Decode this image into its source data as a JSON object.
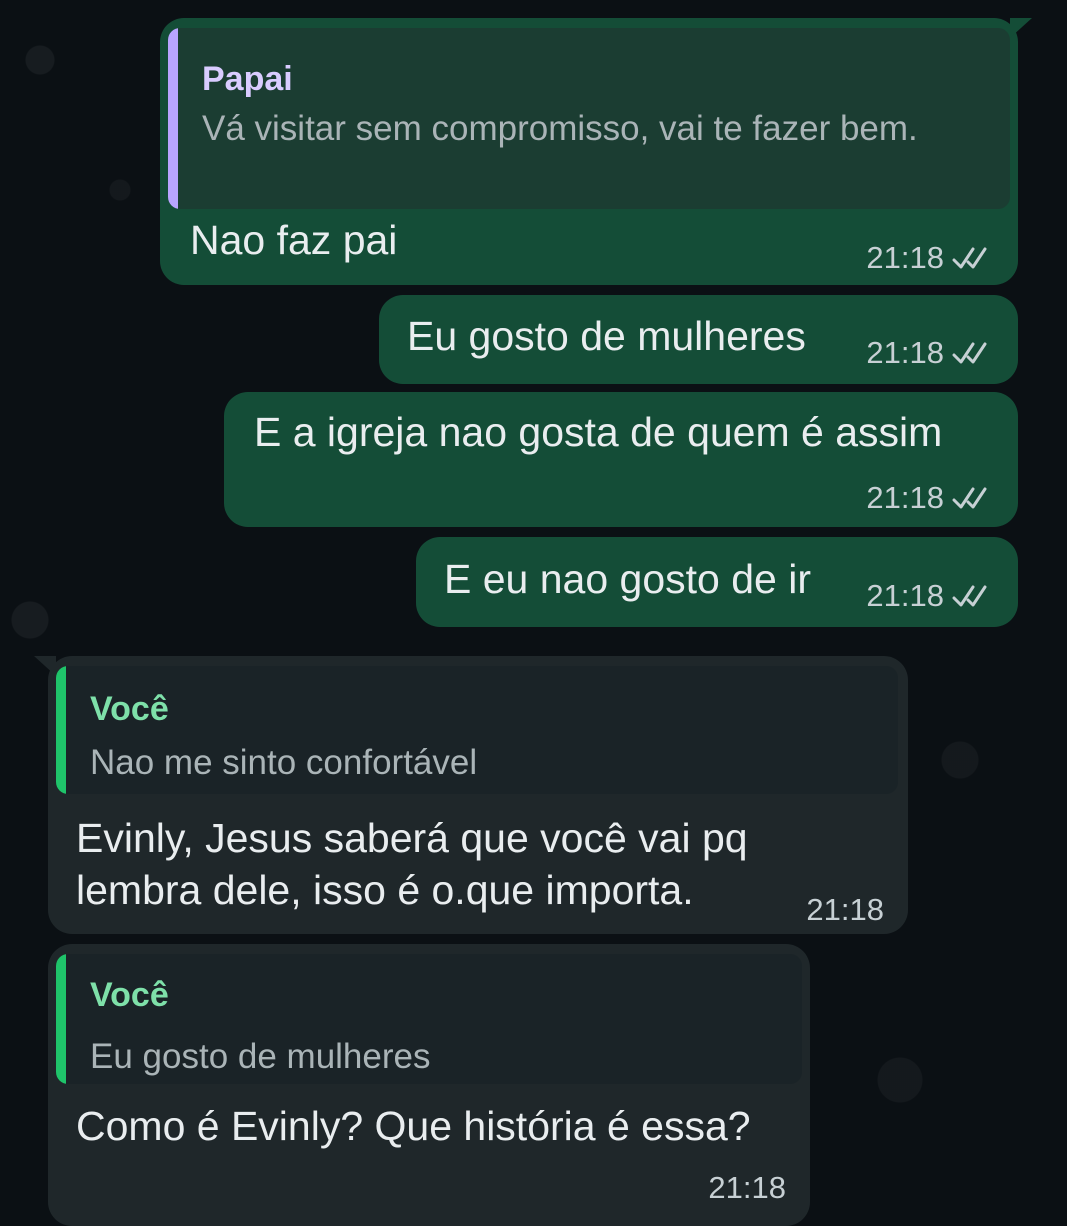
{
  "colors": {
    "background": "#0b1014",
    "outgoing_bubble": "#144d37",
    "incoming_bubble": "#1f272a",
    "quote_bg_outgoing": "#1b3d32",
    "quote_bg_incoming": "#1a2327",
    "quote_bar_papai": "#b9a4ff",
    "quote_bar_voce": "#1fc46a",
    "quote_name_papai": "#d9ccff",
    "quote_name_voce": "#7ee0a9"
  },
  "messages": [
    {
      "direction": "outgoing",
      "quote": {
        "author": "Papai",
        "text": "Vá visitar sem compromisso,  vai te fazer bem."
      },
      "text": "Nao faz pai",
      "time": "21:18",
      "status_icon": "double-check-icon"
    },
    {
      "direction": "outgoing",
      "text": "Eu gosto de mulheres",
      "time": "21:18",
      "status_icon": "double-check-icon"
    },
    {
      "direction": "outgoing",
      "text": "E a igreja nao gosta de quem é assim",
      "time": "21:18",
      "status_icon": "double-check-icon"
    },
    {
      "direction": "outgoing",
      "text": "E eu nao gosto de ir",
      "time": "21:18",
      "status_icon": "double-check-icon"
    },
    {
      "direction": "incoming",
      "quote": {
        "author": "Você",
        "text": "Nao me sinto confortável"
      },
      "text_lines": [
        "Evinly,  Jesus saberá que você vai pq",
        "lembra dele, isso é o.que importa."
      ],
      "time": "21:18"
    },
    {
      "direction": "incoming",
      "quote": {
        "author": "Você",
        "text": "Eu gosto de mulheres"
      },
      "text": "Como é Evinly? Que história é essa?",
      "time": "21:18"
    }
  ]
}
